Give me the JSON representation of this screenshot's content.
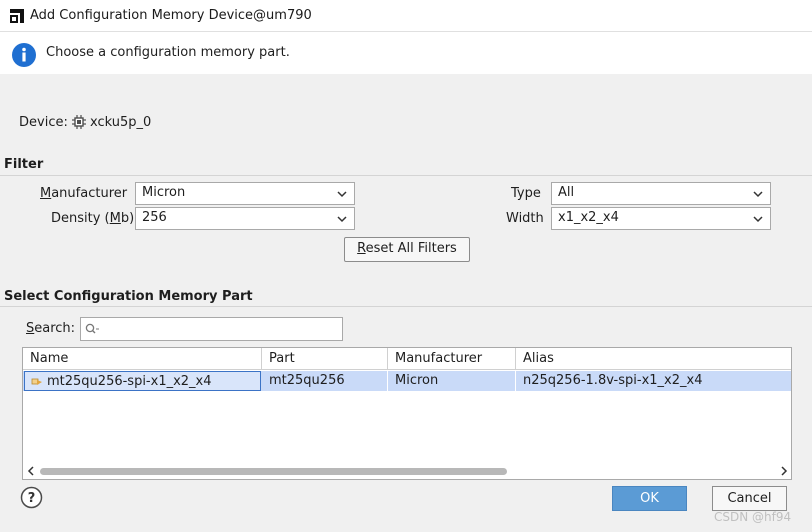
{
  "window": {
    "title": "Add Configuration Memory Device@um790"
  },
  "info": {
    "message": "Choose a configuration memory part."
  },
  "device": {
    "label": "Device:",
    "value": "xcku5p_0"
  },
  "filter": {
    "section_title": "Filter",
    "manufacturer": {
      "label_pre": "",
      "label_mn": "M",
      "label_post": "anufacturer",
      "value": "Micron"
    },
    "density": {
      "label_pre": "Density (",
      "label_mn": "M",
      "label_post": "b)",
      "value": "256"
    },
    "type": {
      "label": "Type",
      "value": "All"
    },
    "width": {
      "label": "Width",
      "value": "x1_x2_x4"
    },
    "reset_mn": "R",
    "reset_rest": "eset All Filters"
  },
  "select": {
    "section_title": "Select Configuration Memory Part",
    "search_label_mn": "S",
    "search_label_rest": "earch:",
    "search_value": "",
    "search_placeholder": ""
  },
  "table": {
    "columns": [
      "Name",
      "Part",
      "Manufacturer",
      "Alias"
    ],
    "rows": [
      {
        "name": "mt25qu256-spi-x1_x2_x4",
        "part": "mt25qu256",
        "manufacturer": "Micron",
        "alias": "n25q256-1.8v-spi-x1_x2_x4"
      }
    ]
  },
  "buttons": {
    "ok": "OK",
    "cancel": "Cancel",
    "help": "?"
  },
  "watermark": "CSDN @hf94",
  "colors": {
    "accent": "#5b9bd5",
    "info_icon": "#1f6fd1",
    "selection": "#c9daf8"
  }
}
